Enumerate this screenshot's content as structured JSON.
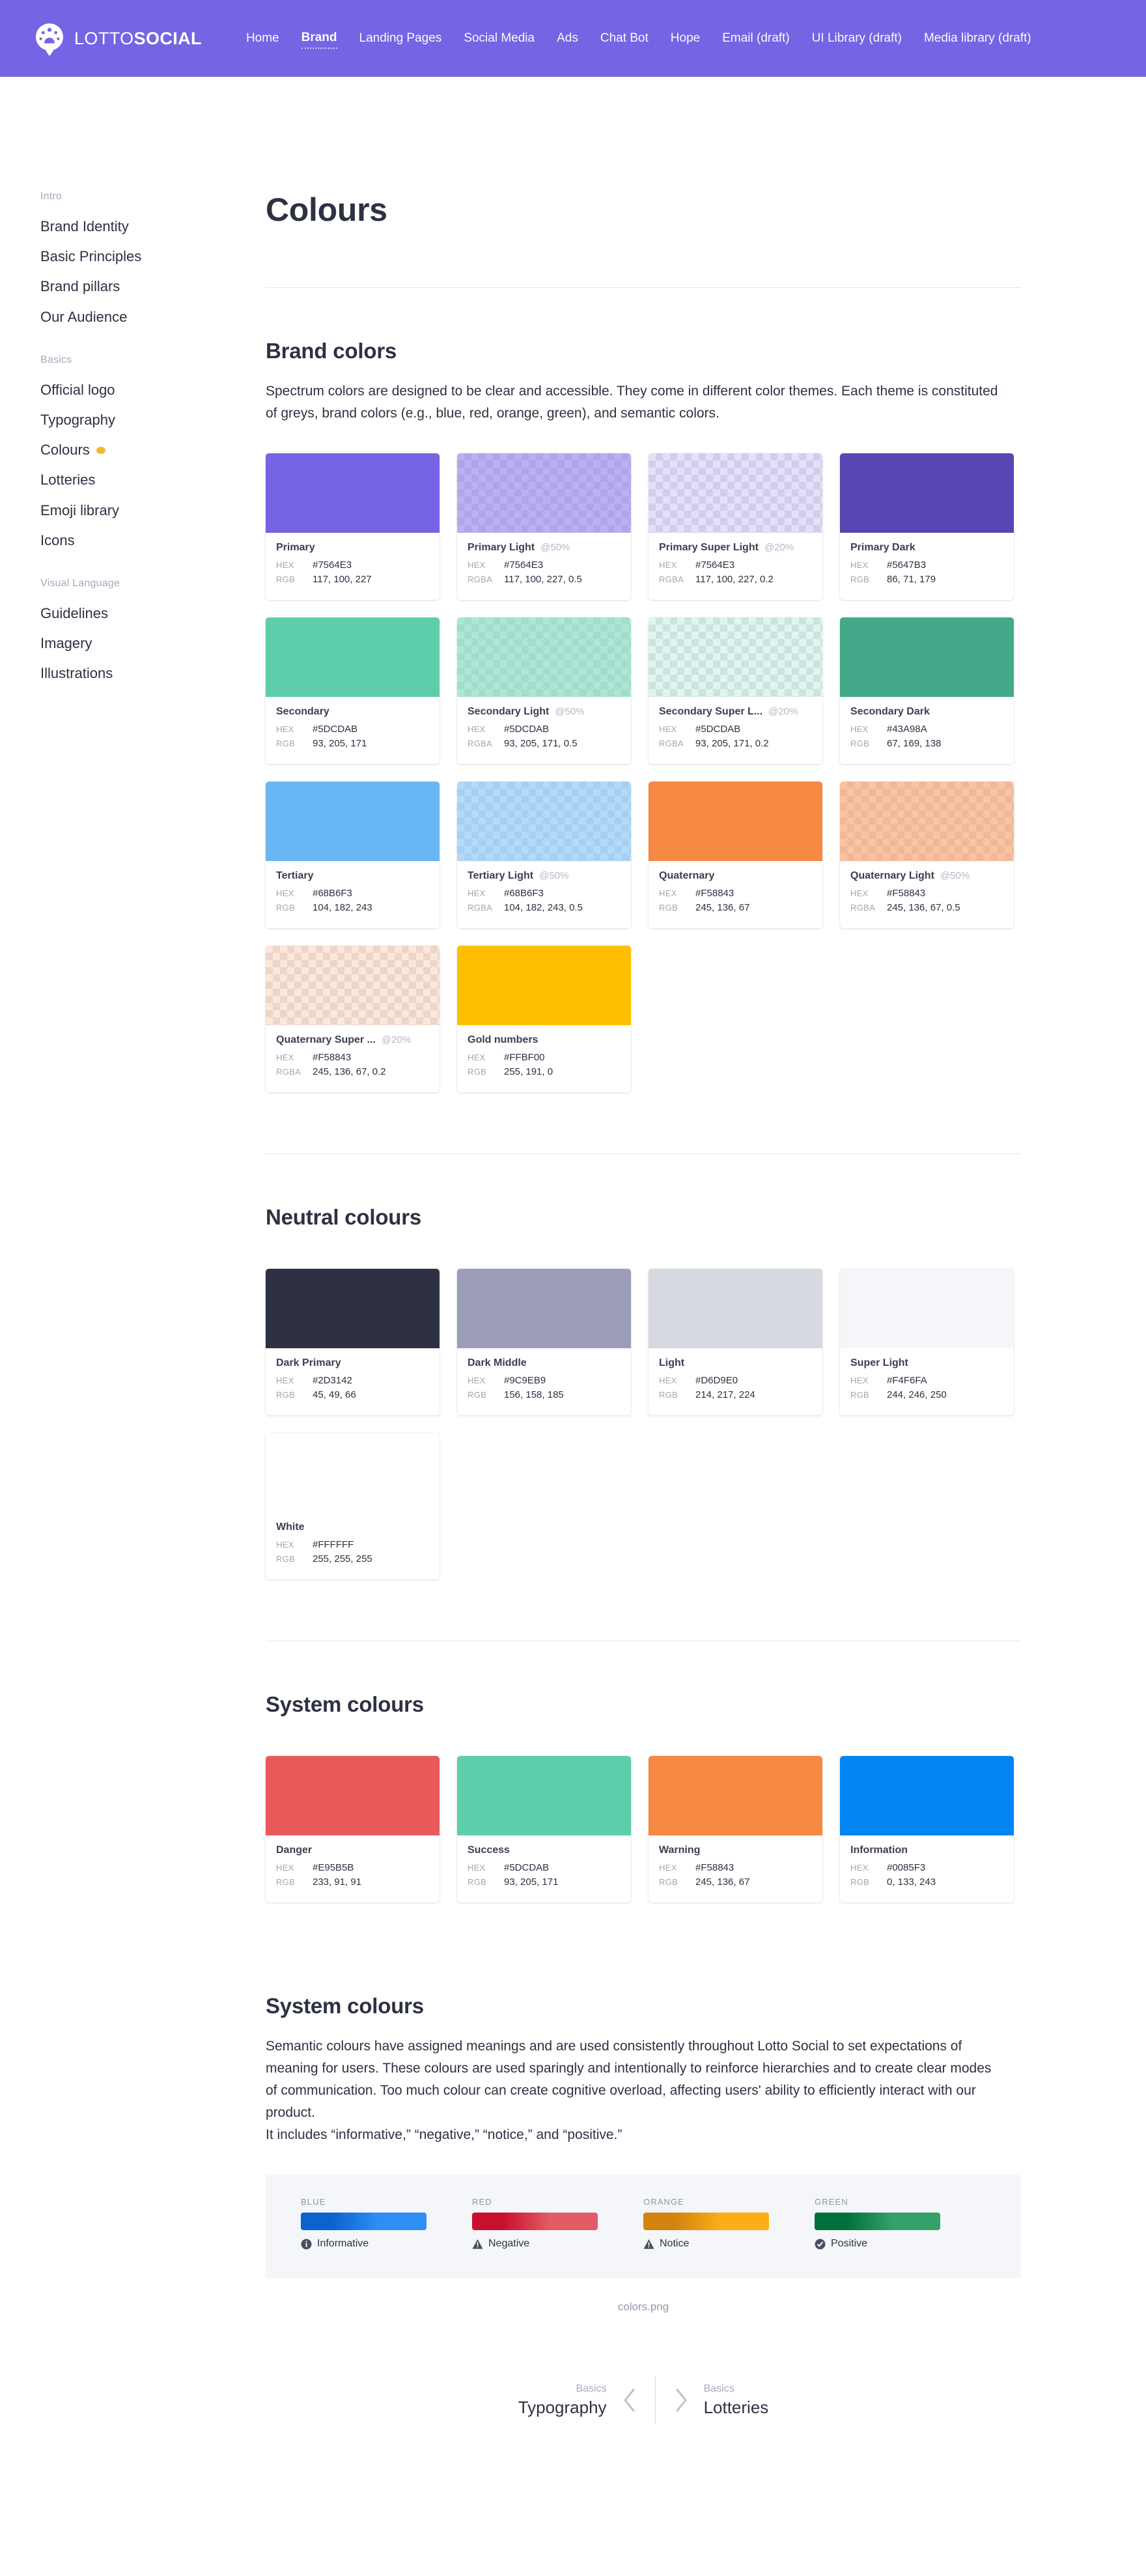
{
  "topbar": {
    "logo_text_light": "LOTTO",
    "logo_text_bold": "SOCIAL",
    "logo_icon": "lotto-social-pin-logo",
    "background": "#7564E3",
    "nav": [
      {
        "label": "Home",
        "active": false
      },
      {
        "label": "Brand",
        "active": true
      },
      {
        "label": "Landing Pages",
        "active": false
      },
      {
        "label": "Social Media",
        "active": false
      },
      {
        "label": "Ads",
        "active": false
      },
      {
        "label": "Chat Bot",
        "active": false
      },
      {
        "label": "Hope",
        "active": false
      },
      {
        "label": "Email (draft)",
        "active": false
      },
      {
        "label": "UI Library (draft)",
        "active": false
      },
      {
        "label": "Media library (draft)",
        "active": false
      }
    ]
  },
  "sidebar": {
    "groups": [
      {
        "title": "Intro",
        "items": [
          {
            "label": "Brand Identity",
            "active": false,
            "badge": ""
          },
          {
            "label": "Basic Principles",
            "active": false,
            "badge": ""
          },
          {
            "label": "Brand pillars",
            "active": false,
            "badge": ""
          },
          {
            "label": "Our Audience",
            "active": false,
            "badge": ""
          }
        ]
      },
      {
        "title": "Basics",
        "items": [
          {
            "label": "Official logo",
            "active": false,
            "badge": ""
          },
          {
            "label": "Typography",
            "active": false,
            "badge": ""
          },
          {
            "label": "Colours",
            "active": true,
            "badge": "yellow-dot"
          },
          {
            "label": "Lotteries",
            "active": false,
            "badge": ""
          },
          {
            "label": "Emoji library",
            "active": false,
            "badge": ""
          },
          {
            "label": "Icons",
            "active": false,
            "badge": ""
          }
        ]
      },
      {
        "title": "Visual Language",
        "items": [
          {
            "label": "Guidelines",
            "active": false,
            "badge": ""
          },
          {
            "label": "Imagery",
            "active": false,
            "badge": ""
          },
          {
            "label": "Illustrations",
            "active": false,
            "badge": ""
          }
        ]
      }
    ]
  },
  "page": {
    "title": "Colours"
  },
  "brand_section": {
    "title": "Brand colors",
    "body": "Spectrum colors are designed to be clear and accessible. They come in different color themes. Each theme is constituted of greys, brand colors (e.g., blue, red, orange, green), and semantic colors.",
    "key_hex": "HEX",
    "key_rgb": "RGB",
    "key_rgba": "RGBA",
    "swatches": [
      {
        "name": "Primary",
        "alpha": "",
        "hex": "#7564E3",
        "rgb_key": "RGB",
        "rgb": "117, 100, 227",
        "css": "rgb(117,100,227)",
        "checker": false
      },
      {
        "name": "Primary Light",
        "alpha": "@50%",
        "hex": "#7564E3",
        "rgb_key": "RGBA",
        "rgb": "117, 100, 227, 0.5",
        "css": "rgba(117,100,227,0.5)",
        "checker": true
      },
      {
        "name": "Primary Super Light",
        "alpha": "@20%",
        "hex": "#7564E3",
        "rgb_key": "RGBA",
        "rgb": "117, 100, 227, 0.2",
        "css": "rgba(117,100,227,0.2)",
        "checker": true
      },
      {
        "name": "Primary Dark",
        "alpha": "",
        "hex": "#5647B3",
        "rgb_key": "RGB",
        "rgb": "86, 71, 179",
        "css": "rgb(86,71,179)",
        "checker": false
      },
      {
        "name": "Secondary",
        "alpha": "",
        "hex": "#5DCDAB",
        "rgb_key": "RGB",
        "rgb": "93, 205, 171",
        "css": "rgb(93,205,171)",
        "checker": false
      },
      {
        "name": "Secondary Light",
        "alpha": "@50%",
        "hex": "#5DCDAB",
        "rgb_key": "RGBA",
        "rgb": "93, 205, 171, 0.5",
        "css": "rgba(93,205,171,0.5)",
        "checker": true
      },
      {
        "name": "Secondary Super L...",
        "alpha": "@20%",
        "hex": "#5DCDAB",
        "rgb_key": "RGBA",
        "rgb": "93, 205, 171, 0.2",
        "css": "rgba(93,205,171,0.2)",
        "checker": true
      },
      {
        "name": "Secondary Dark",
        "alpha": "",
        "hex": "#43A98A",
        "rgb_key": "RGB",
        "rgb": "67, 169, 138",
        "css": "rgb(67,169,138)",
        "checker": false
      },
      {
        "name": "Tertiary",
        "alpha": "",
        "hex": "#68B6F3",
        "rgb_key": "RGB",
        "rgb": "104, 182, 243",
        "css": "rgb(104,182,243)",
        "checker": false
      },
      {
        "name": "Tertiary Light",
        "alpha": "@50%",
        "hex": "#68B6F3",
        "rgb_key": "RGBA",
        "rgb": "104, 182, 243, 0.5",
        "css": "rgba(104,182,243,0.5)",
        "checker": true
      },
      {
        "name": "Quaternary",
        "alpha": "",
        "hex": "#F58843",
        "rgb_key": "RGB",
        "rgb": "245, 136, 67",
        "css": "rgb(245,136,67)",
        "checker": false
      },
      {
        "name": "Quaternary Light",
        "alpha": "@50%",
        "hex": "#F58843",
        "rgb_key": "RGBA",
        "rgb": "245, 136, 67, 0.5",
        "css": "rgba(245,136,67,0.5)",
        "checker": true
      },
      {
        "name": "Quaternary Super ...",
        "alpha": "@20%",
        "hex": "#F58843",
        "rgb_key": "RGBA",
        "rgb": "245, 136, 67, 0.2",
        "css": "rgba(245,136,67,0.2)",
        "checker": true
      },
      {
        "name": "Gold numbers",
        "alpha": "",
        "hex": "#FFBF00",
        "rgb_key": "RGB",
        "rgb": "255, 191, 0",
        "css": "rgb(255,191,0)",
        "checker": false
      }
    ]
  },
  "neutral_section": {
    "title": "Neutral colours",
    "swatches": [
      {
        "name": "Dark Primary",
        "alpha": "",
        "hex": "#2D3142",
        "rgb_key": "RGB",
        "rgb": "45, 49, 66",
        "css": "rgb(45,49,66)",
        "checker": false
      },
      {
        "name": "Dark Middle",
        "alpha": "",
        "hex": "#9C9EB9",
        "rgb_key": "RGB",
        "rgb": "156, 158, 185",
        "css": "rgb(156,158,185)",
        "checker": false
      },
      {
        "name": "Light",
        "alpha": "",
        "hex": "#D6D9E0",
        "rgb_key": "RGB",
        "rgb": "214, 217, 224",
        "css": "rgb(214,217,224)",
        "checker": false
      },
      {
        "name": "Super Light",
        "alpha": "",
        "hex": "#F4F6FA",
        "rgb_key": "RGB",
        "rgb": "244, 246, 250",
        "css": "rgb(244,246,250)",
        "checker": false
      },
      {
        "name": "White",
        "alpha": "",
        "hex": "#FFFFFF",
        "rgb_key": "RGB",
        "rgb": "255, 255, 255",
        "css": "rgb(255,255,255)",
        "checker": false
      }
    ]
  },
  "system_section": {
    "title": "System colours",
    "swatches": [
      {
        "name": "Danger",
        "alpha": "",
        "hex": "#E95B5B",
        "rgb_key": "RGB",
        "rgb": "233, 91, 91",
        "css": "rgb(233,91,91)",
        "checker": false
      },
      {
        "name": "Success",
        "alpha": "",
        "hex": "#5DCDAB",
        "rgb_key": "RGB",
        "rgb": "93, 205, 171",
        "css": "rgb(93,205,171)",
        "checker": false
      },
      {
        "name": "Warning",
        "alpha": "",
        "hex": "#F58843",
        "rgb_key": "RGB",
        "rgb": "245, 136, 67",
        "css": "rgb(245,136,67)",
        "checker": false
      },
      {
        "name": "Information",
        "alpha": "",
        "hex": "#0085F3",
        "rgb_key": "RGB",
        "rgb": "0, 133, 243",
        "css": "rgb(0,133,243)",
        "checker": false
      }
    ]
  },
  "semantics_section": {
    "title": "System colours",
    "body_line1": "Semantic colours have assigned meanings and are used consistently throughout Lotto Social to set expectations of meaning for users. These colours are used sparingly and intentionally to reinforce hierarchies and to create clear modes of communication. Too much colour can create cognitive overload, affecting users' ability to efficiently interact with our product.",
    "body_line2": "It includes “informative,” “negative,” “notice,” and “positive.”",
    "figure_caption": "colors.png",
    "figure": [
      {
        "caption": "BLUE",
        "label": "Informative",
        "icon": "info-circle-icon",
        "start": "#0B63CE",
        "end": "#2D8FF5"
      },
      {
        "caption": "RED",
        "label": "Negative",
        "icon": "warning-triangle-icon",
        "start": "#C8102E",
        "end": "#E35C63"
      },
      {
        "caption": "ORANGE",
        "label": "Notice",
        "icon": "warning-triangle-icon",
        "start": "#D2830F",
        "end": "#FDAE17"
      },
      {
        "caption": "GREEN",
        "label": "Positive",
        "icon": "check-circle-icon",
        "start": "#00703C",
        "end": "#35A06A"
      }
    ]
  },
  "footer_nav": {
    "prev": {
      "kicker": "Basics",
      "title": "Typography",
      "icon": "chevron-left-icon"
    },
    "next": {
      "kicker": "Basics",
      "title": "Lotteries",
      "icon": "chevron-right-icon"
    }
  }
}
